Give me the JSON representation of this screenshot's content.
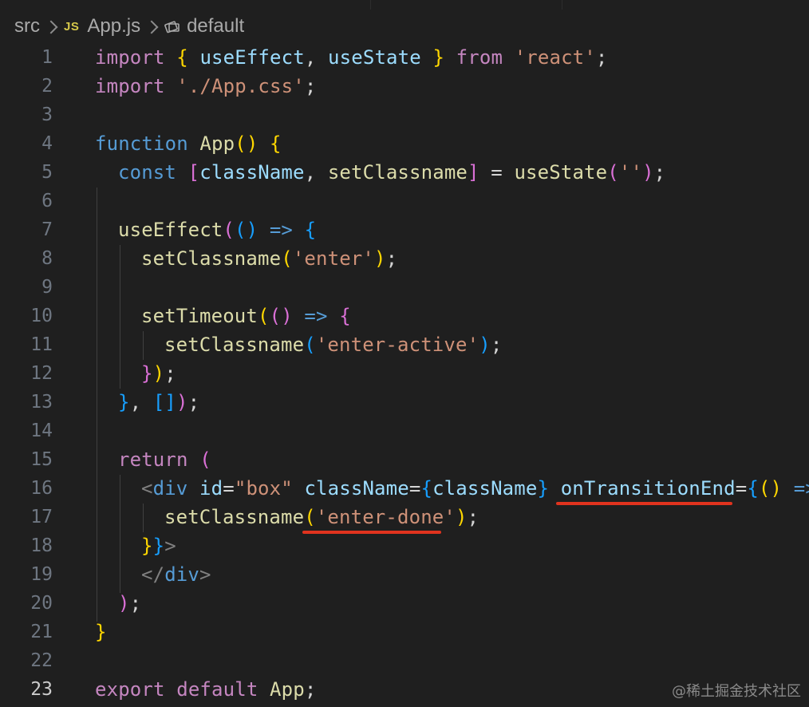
{
  "breadcrumb": {
    "folder": "src",
    "file_badge": "JS",
    "file": "App.js",
    "symbol": "default"
  },
  "editor": {
    "active_line": "23",
    "line_numbers": [
      "1",
      "2",
      "3",
      "4",
      "5",
      "6",
      "7",
      "8",
      "9",
      "10",
      "11",
      "12",
      "13",
      "14",
      "15",
      "16",
      "17",
      "18",
      "19",
      "20",
      "21",
      "22",
      "23"
    ],
    "tokens": {
      "l1": [
        "import",
        " ",
        "{",
        " ",
        "useEffect",
        ", ",
        "useState",
        " ",
        "}",
        " ",
        "from",
        " ",
        "'react'",
        ";"
      ],
      "l2": [
        "import",
        " ",
        "'./App.css'",
        ";"
      ],
      "l4": [
        "function",
        " ",
        "App",
        "()",
        " ",
        "{"
      ],
      "l5": [
        "const",
        " ",
        "[",
        "className",
        ", ",
        "setClassname",
        "]",
        " = ",
        "useState",
        "(",
        "''",
        ")",
        ";"
      ],
      "l7": [
        "useEffect",
        "(",
        "()",
        " ",
        "=>",
        " ",
        "{"
      ],
      "l8": [
        "setClassname",
        "(",
        "'enter'",
        ")",
        ";"
      ],
      "l10": [
        "setTimeout",
        "(",
        "()",
        " ",
        "=>",
        " ",
        "{"
      ],
      "l11": [
        "setClassname",
        "(",
        "'enter-active'",
        ")",
        ";"
      ],
      "l12": [
        "}",
        ")",
        ";"
      ],
      "l13": [
        "}",
        ", ",
        "[]",
        ")",
        ";"
      ],
      "l15": [
        "return",
        " ",
        "("
      ],
      "l16": [
        "<",
        "div",
        " ",
        "id",
        "=",
        "\"box\"",
        " ",
        "className",
        "=",
        "{",
        "className",
        "}",
        " ",
        "onTransitionEnd",
        "=",
        "{",
        "()",
        " ",
        "=>"
      ],
      "l17": [
        "setClassname",
        "(",
        "'enter-done'",
        ")",
        ";"
      ],
      "l18": [
        "}",
        "}",
        ">"
      ],
      "l19": [
        "</",
        "div",
        ">"
      ],
      "l20": [
        ")",
        ";"
      ],
      "l21": [
        "}"
      ],
      "l23": [
        "export",
        " ",
        "default",
        " ",
        "App",
        ";"
      ]
    }
  },
  "colors": {
    "background": "#1f1f1f",
    "keyword_control": "#c586c0",
    "keyword_storage": "#569cd6",
    "function": "#dcdcaa",
    "string": "#ce9178",
    "variable": "#9cdcfe",
    "annotation_underline": "#e0331e"
  },
  "icons": {
    "breadcrumb_separator": "chevron-right-icon",
    "file_type": "javascript-file-icon",
    "symbol": "symbol-namespace-icon"
  },
  "watermark": "@稀土掘金技术社区"
}
